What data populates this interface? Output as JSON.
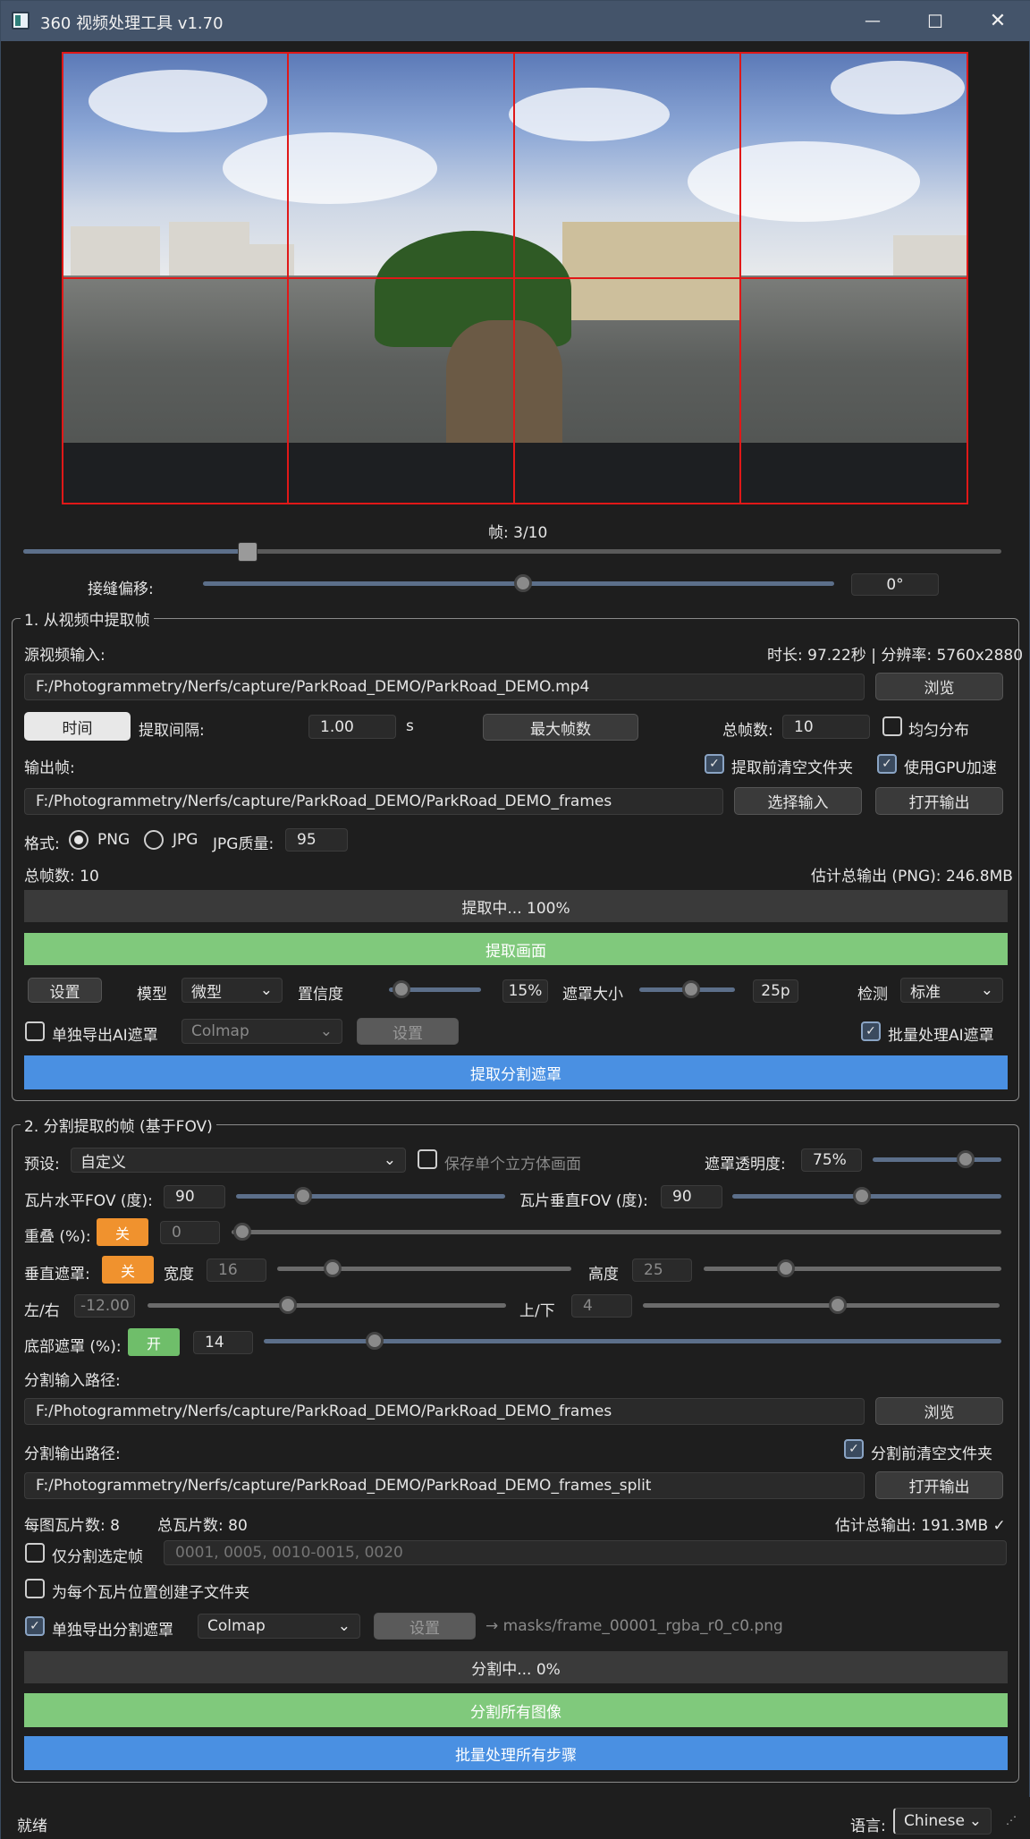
{
  "window": {
    "title": "360 视频处理工具 v1.70",
    "minimize": "—",
    "maximize": "☐",
    "close": "✕"
  },
  "preview": {
    "frame_label": "帧: 3/10",
    "frame_value": 3,
    "frame_total": 10,
    "seam_label": "接缝偏移:",
    "seam_value": "0°"
  },
  "extract": {
    "group_title": "1. 从视频中提取帧",
    "source_label": "源视频输入:",
    "info": "时长: 97.22秒 | 分辨率: 5760x2880",
    "source_path": "F:/Photogrammetry/Nerfs/capture/ParkRoad_DEMO/ParkRoad_DEMO.mp4",
    "browse": "浏览",
    "time_btn": "时间",
    "interval_label": "提取间隔:",
    "interval_value": "1.00",
    "interval_unit": "s",
    "max_frames_btn": "最大帧数",
    "total_label": "总帧数:",
    "total_value": "10",
    "even_label": "均匀分布",
    "output_label": "输出帧:",
    "clear_label": "提取前清空文件夹",
    "gpu_label": "使用GPU加速",
    "output_path": "F:/Photogrammetry/Nerfs/capture/ParkRoad_DEMO/ParkRoad_DEMO_frames",
    "select_input": "选择输入",
    "open_output": "打开输出",
    "format_label": "格式:",
    "png": "PNG",
    "jpg": "JPG",
    "jpg_quality_label": "JPG质量:",
    "jpg_quality": "95",
    "frame_count": "总帧数: 10",
    "est_output": "估计总输出 (PNG): 246.8MB",
    "progress": "提取中... 100%",
    "progress_value": 1.0,
    "extract_btn": "提取画面",
    "settings_btn": "设置",
    "model_label": "模型",
    "model_value": "微型",
    "conf_label": "置信度",
    "conf_value": "15%",
    "mask_size_label": "遮罩大小",
    "mask_size_value": "25p",
    "detect_label": "检测",
    "detect_value": "标准",
    "export_ai_label": "单独导出AI遮罩",
    "colmap_value": "Colmap",
    "settings2": "设置",
    "batch_ai_label": "批量处理AI遮罩",
    "extract_mask_btn": "提取分割遮罩"
  },
  "split": {
    "group_title": "2. 分割提取的帧 (基于FOV)",
    "preset_label": "预设:",
    "preset_value": "自定义",
    "save_cube_label": "保存单个立方体画面",
    "mask_opacity_label": "遮罩透明度:",
    "mask_opacity_value": "75%",
    "hfov_label": "瓦片水平FOV (度):",
    "hfov_value": "90",
    "vfov_label": "瓦片垂直FOV (度):",
    "vfov_value": "90",
    "overlap_label": "重叠 (%):",
    "overlap_toggle": "关",
    "overlap_value": "0",
    "vmask_label": "垂直遮罩:",
    "vmask_toggle": "关",
    "width_label": "宽度",
    "width_value": "16",
    "height_label": "高度",
    "height_value": "25",
    "lr_label": "左/右",
    "lr_value": "-12.00",
    "ud_label": "上/下",
    "ud_value": "4",
    "bottom_label": "底部遮罩 (%):",
    "bottom_toggle": "开",
    "bottom_value": "14",
    "input_label": "分割输入路径:",
    "input_path": "F:/Photogrammetry/Nerfs/capture/ParkRoad_DEMO/ParkRoad_DEMO_frames",
    "browse": "浏览",
    "output_label": "分割输出路径:",
    "clear_label": "分割前清空文件夹",
    "output_path": "F:/Photogrammetry/Nerfs/capture/ParkRoad_DEMO/ParkRoad_DEMO_frames_split",
    "open_output": "打开输出",
    "tiles_per": "每图瓦片数: 8",
    "tiles_total": "总瓦片数: 80",
    "est_output": "估计总输出: 191.3MB ✓",
    "only_selected_label": "仅分割选定帧",
    "only_selected_placeholder": "0001, 0005, 0010-0015, 0020",
    "subfolder_label": "为每个瓦片位置创建子文件夹",
    "export_mask_label": "单独导出分割遮罩",
    "colmap_value": "Colmap",
    "settings": "设置",
    "mask_path_hint": "→ masks/frame_00001_rgba_r0_c0.png",
    "progress": "分割中... 0%",
    "progress_value": 0.0,
    "split_all_btn": "分割所有图像",
    "batch_all_btn": "批量处理所有步骤"
  },
  "status": {
    "text": "就绪",
    "lang_label": "语言:",
    "lang_value": "Chinese"
  },
  "colors": {
    "green": "#80c97c",
    "blue": "#4a90e2",
    "orange": "#f0922e",
    "grid": "#e01818"
  }
}
